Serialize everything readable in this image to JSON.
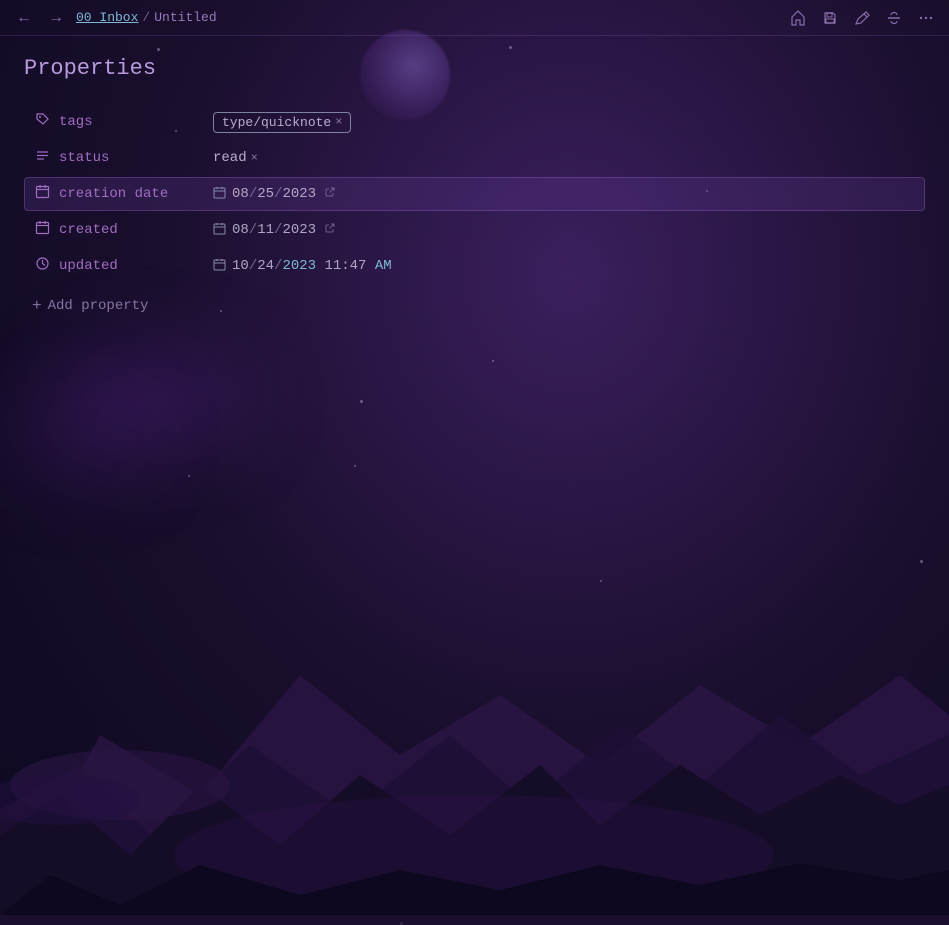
{
  "toolbar": {
    "back_icon": "←",
    "forward_icon": "→",
    "breadcrumb": {
      "parent": "00 Inbox",
      "separator": "/",
      "current": "Untitled"
    },
    "icons": {
      "home": "⌂",
      "save": "⬡",
      "edit": "✎",
      "strikethrough": "—",
      "more": "⋯"
    }
  },
  "properties": {
    "title": "Properties",
    "rows": [
      {
        "id": "tags",
        "icon": "tag",
        "label": "tags",
        "value_type": "tag",
        "tag_value": "type/quicknote",
        "highlighted": false
      },
      {
        "id": "status",
        "icon": "list",
        "label": "status",
        "value_type": "status",
        "status_value": "read",
        "highlighted": false
      },
      {
        "id": "creation_date",
        "icon": "calendar",
        "label": "creation date",
        "value_type": "date",
        "date_month": "08",
        "date_day": "25",
        "date_year": "2023",
        "highlighted": true
      },
      {
        "id": "created",
        "icon": "calendar",
        "label": "created",
        "value_type": "date",
        "date_month": "08",
        "date_day": "11",
        "date_year": "2023",
        "highlighted": false
      },
      {
        "id": "updated",
        "icon": "clock",
        "label": "updated",
        "value_type": "datetime",
        "date_month": "10",
        "date_day": "24",
        "date_year": "2023",
        "time": "11:47",
        "ampm": "AM",
        "highlighted": false
      }
    ],
    "add_property_label": "+ Add property"
  }
}
